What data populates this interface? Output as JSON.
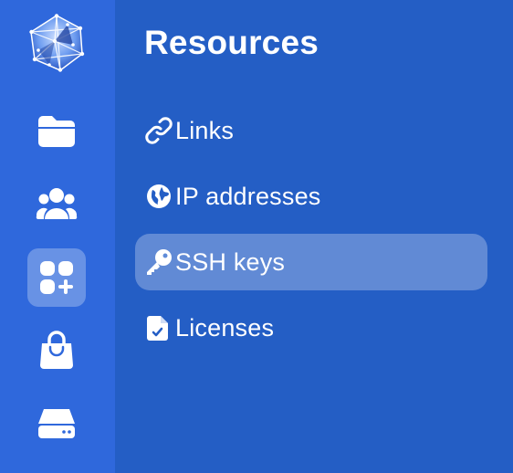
{
  "panel": {
    "title": "Resources",
    "items": [
      {
        "label": "Links",
        "icon": "link-icon"
      },
      {
        "label": "IP addresses",
        "icon": "globe-icon"
      },
      {
        "label": "SSH keys",
        "icon": "key-icon",
        "active": true
      },
      {
        "label": "Licenses",
        "icon": "license-document-icon"
      }
    ]
  },
  "rail": {
    "icons": [
      "logo",
      "folder-icon",
      "team-icon",
      "apps-add-icon",
      "shopping-bag-icon",
      "server-icon"
    ],
    "active": "apps-add-icon"
  },
  "colors": {
    "rail_bg": "#2f68dc",
    "panel_bg": "#245ec5",
    "active_bg": "rgba(255,255,255,0.28)",
    "text": "#ffffff"
  }
}
